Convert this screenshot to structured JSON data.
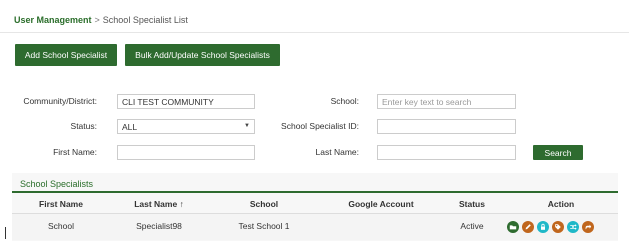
{
  "breadcrumb": {
    "root": "User Management",
    "separator": ">",
    "current": "School Specialist List"
  },
  "toolbar": {
    "add_label": "Add School Specialist",
    "bulk_label": "Bulk Add/Update School Specialists"
  },
  "filters": {
    "community_label": "Community/District:",
    "community_value": "CLI TEST COMMUNITY",
    "school_label": "School:",
    "school_placeholder": "Enter key text to search",
    "status_label": "Status:",
    "status_value": "ALL",
    "specialist_id_label": "School Specialist ID:",
    "first_name_label": "First Name:",
    "last_name_label": "Last Name:",
    "search_label": "Search"
  },
  "panel": {
    "title": "School Specialists"
  },
  "table": {
    "headers": [
      "First Name",
      "Last Name",
      "School",
      "Google Account",
      "Status",
      "Action"
    ],
    "sort_indicator": "↑",
    "rows": [
      {
        "first_name": "School",
        "last_name": "Specialist98",
        "school": "Test School 1",
        "google_account": "",
        "status": "Active"
      }
    ]
  },
  "action_icons": [
    {
      "name": "folder-icon",
      "color": "#2e6b2f"
    },
    {
      "name": "edit-icon",
      "color": "#c0661d"
    },
    {
      "name": "lock-icon",
      "color": "#1fb8c8"
    },
    {
      "name": "tag-icon",
      "color": "#c0661d"
    },
    {
      "name": "shuffle-icon",
      "color": "#1fb8c8"
    },
    {
      "name": "share-icon",
      "color": "#c0661d"
    }
  ],
  "colors": {
    "brand_green": "#2e6b2f",
    "accent_orange": "#c0661d",
    "accent_cyan": "#1fb8c8"
  }
}
